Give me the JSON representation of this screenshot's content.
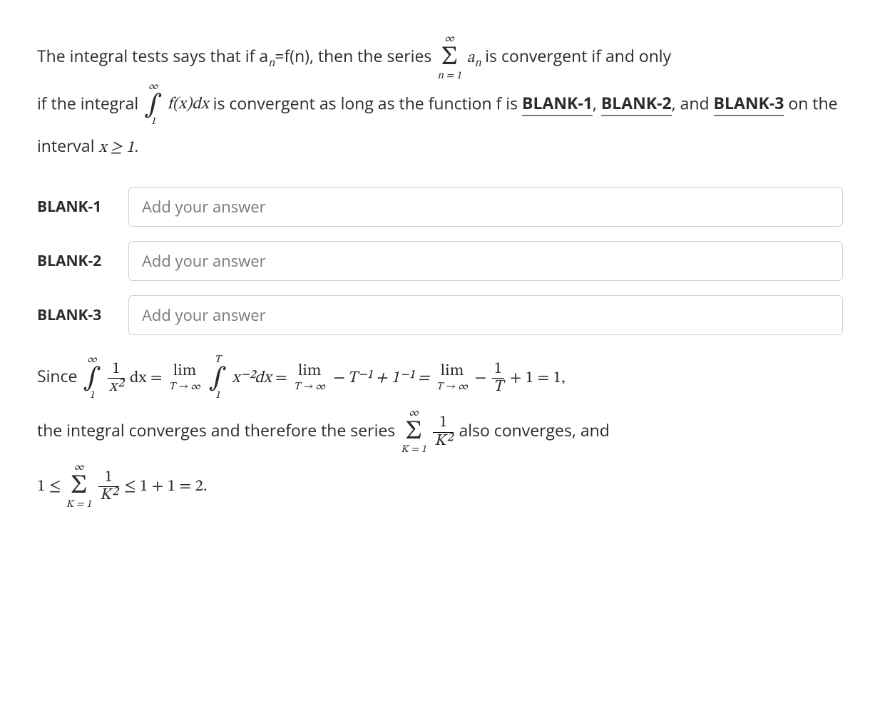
{
  "q": {
    "line1_a": "The integral tests says that if a",
    "line1_sub": "n",
    "line1_b": "=f(n), then the series ",
    "sum1_top": "∞",
    "sum1_sym": "Σ",
    "sum1_bot": "n = 1",
    "sum1_term_a": "a",
    "sum1_term_sub": "n",
    "line1_c": " is convergent if and only",
    "line2_a": "if the integral ",
    "int1_top": "∞",
    "int1_sym": "∫",
    "int1_bot": "1",
    "int1_body": "f(x)dx",
    "line2_b": " is convergent as long as the function f is ",
    "blank1_ref": "BLANK-1",
    "sep1": ", ",
    "blank2_ref": "BLANK-2",
    "sep2": ", and ",
    "blank3_ref": "BLANK-3",
    "line2_c": " on the interval ",
    "interval": "x ≥ 1",
    "period": "."
  },
  "blanks": {
    "b1_label": "BLANK-1",
    "b2_label": "BLANK-2",
    "b3_label": "BLANK-3",
    "placeholder": "Add your answer"
  },
  "sol": {
    "since": "Since ",
    "int2_top": "∞",
    "int2_bot": "1",
    "int2_sym": "∫",
    "frac1_top": "1",
    "frac1_bot": "x²",
    "dx_eq": "dx = ",
    "lim_label": "lim",
    "lim_sub": "T → ∞",
    "int3_top": "T",
    "int3_bot": "1",
    "int3_sym": "∫",
    "int3_body": "x⁻²dx",
    "eq2": " = ",
    "mid": " − T⁻¹ + 1⁻¹ = ",
    "minus": " − ",
    "frac2_top": "1",
    "frac2_bot": "T",
    "tail": " + 1 = 1,",
    "line2": "the integral converges and therefore the series ",
    "sum2_top": "∞",
    "sum2_sym": "Σ",
    "sum2_bot": "K = 1",
    "frac3_top": "1",
    "frac3_bot": "K²",
    "line2b": " also converges, and",
    "bound_a": "1 ≤ ",
    "bound_b": " ≤ 1 + 1 = 2."
  }
}
